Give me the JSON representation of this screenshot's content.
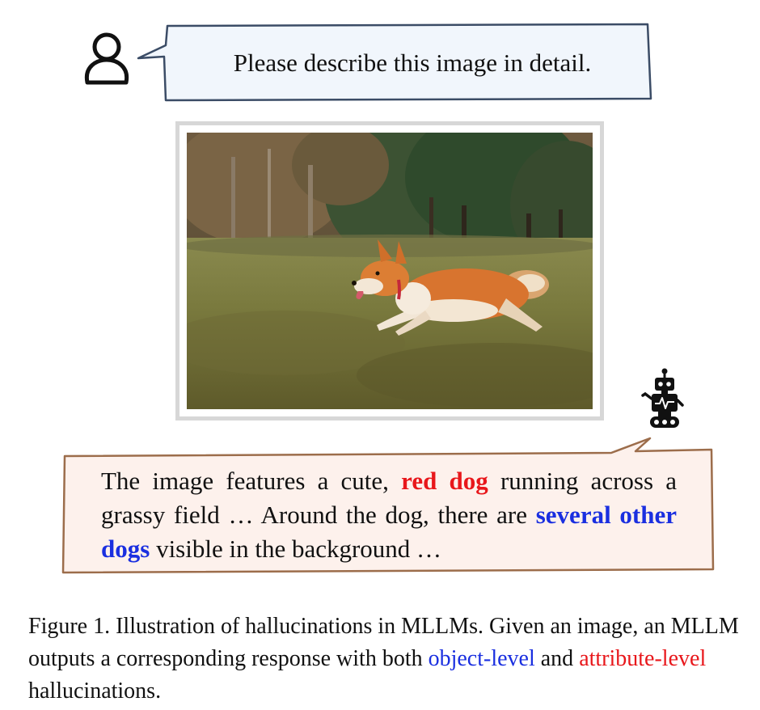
{
  "user": {
    "icon": "user-icon",
    "prompt": "Please describe this image in detail."
  },
  "photo": {
    "subject": "dog-running-photo"
  },
  "model": {
    "icon": "robot-icon",
    "response": {
      "p1": "The image features a cute, ",
      "h1": "red dog",
      "p2": " running across a grassy field … Around the dog, there are ",
      "h2": "several other dogs",
      "p3": " visible in the background …"
    }
  },
  "caption": {
    "p1": "Figure 1. Illustration of hallucinations in MLLMs. Given an image, an MLLM outputs a corresponding response with both ",
    "obj": "object-level",
    "p2": " and ",
    "attr": "attribute-level",
    "p3": " hallucinations."
  },
  "colors": {
    "user_bubble_stroke": "#3b4c66",
    "user_bubble_fill": "#f1f6fc",
    "response_bubble_stroke": "#9c6d4b",
    "response_bubble_fill": "#fdf1ec",
    "attribute_hallucination": "#e8171b",
    "object_hallucination": "#1a2fe0"
  }
}
